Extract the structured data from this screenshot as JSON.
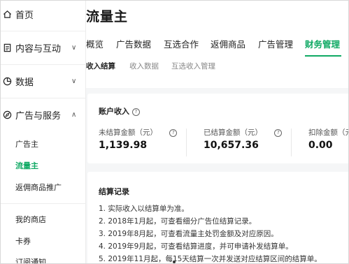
{
  "sidebar": {
    "home": {
      "label": "首页",
      "icon": "home-icon"
    },
    "content": {
      "label": "内容与互动",
      "icon": "document-icon"
    },
    "data": {
      "label": "数据",
      "icon": "pie-chart-icon"
    },
    "ads": {
      "label": "广告与服务",
      "icon": "compass-icon"
    },
    "ads_items": [
      {
        "label": "广告主"
      },
      {
        "label": "流量主"
      },
      {
        "label": "返佣商品推广"
      }
    ],
    "shop": {
      "label": "我的商店"
    },
    "coupon": {
      "label": "卡券"
    },
    "notice": {
      "label": "订阅通知"
    }
  },
  "main": {
    "title": "流量主",
    "tabs": [
      "概览",
      "广告数据",
      "互选合作",
      "返佣商品",
      "广告管理",
      "财务管理"
    ],
    "active_tab": "财务管理",
    "subtabs": [
      "收入结算",
      "收入数据",
      "互选收入管理"
    ],
    "active_subtab": "收入结算"
  },
  "income_card": {
    "title": "账户收入",
    "metrics": [
      {
        "label": "未结算金额（元）",
        "value": "1,139.98"
      },
      {
        "label": "已结算金额（元）",
        "value": "10,657.36"
      },
      {
        "label": "扣除金额（元",
        "value": "0.00"
      }
    ]
  },
  "records_card": {
    "title": "结算记录",
    "lines": [
      "1. 实际收入以结算单为准。",
      "2. 2018年1月起，可查看细分广告位结算记录。",
      "3. 2019年8月起，可查看流量主处罚金额及对应原因。",
      "4. 2019年9月起，可查看结算进度，并可申请补发结算单。",
      "5. 2019年11月起，每15天结算一次并发送对应结算区间的结算单。"
    ]
  },
  "colors": {
    "accent": "#0fa964",
    "background": "#f5f6f7"
  }
}
